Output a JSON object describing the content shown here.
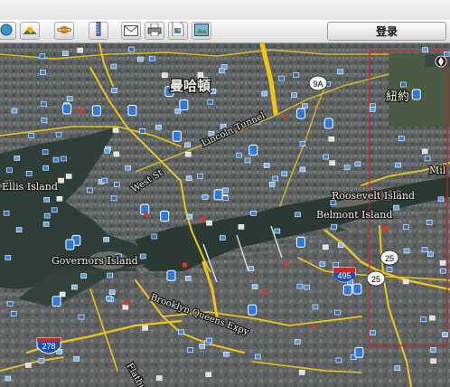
{
  "toolbar": {
    "buttons": [
      {
        "name": "globe-icon"
      },
      {
        "name": "sunlight-icon"
      },
      {
        "name": "planet-icon"
      },
      {
        "name": "ruler-icon"
      },
      {
        "name": "email-icon"
      },
      {
        "name": "print-icon"
      },
      {
        "name": "save-image-icon"
      },
      {
        "name": "map-view-icon"
      }
    ],
    "login_label": "登录"
  },
  "map": {
    "place_labels": [
      {
        "text": "曼哈頓"
      },
      {
        "text": "紐約"
      },
      {
        "text": "Ellis Island"
      },
      {
        "text": "Governors Island"
      },
      {
        "text": "Roosevelt Island"
      },
      {
        "text": "Belmont Island"
      },
      {
        "text": "Mil"
      }
    ],
    "road_labels": [
      {
        "text": "Lincoln Tunnel"
      },
      {
        "text": "West St"
      },
      {
        "text": "Brooklyn Queens Expy"
      },
      {
        "text": "Flatbush"
      }
    ],
    "highway_shields": [
      {
        "text": "9A",
        "type": "state"
      },
      {
        "text": "495",
        "type": "interstate"
      },
      {
        "text": "25",
        "type": "state"
      },
      {
        "text": "25",
        "type": "state"
      },
      {
        "text": "278",
        "type": "interstate"
      }
    ],
    "colors": {
      "selection_box": "#cc2222",
      "road": "#f0c419",
      "water": "#2b3b34",
      "land": "#555b5b"
    }
  }
}
